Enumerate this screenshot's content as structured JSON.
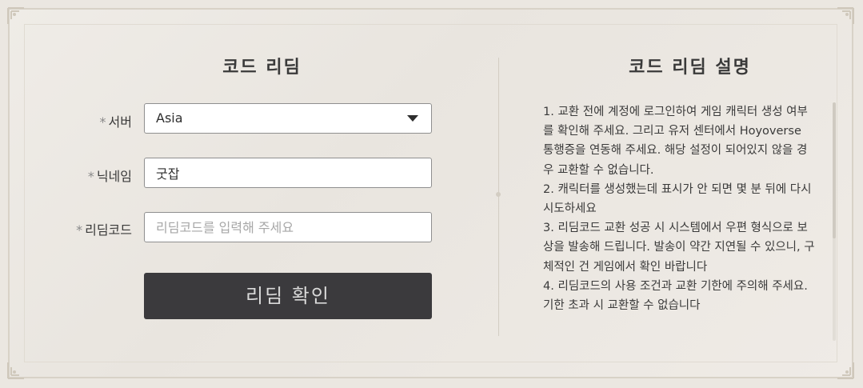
{
  "left": {
    "title": "코드 리딤",
    "server": {
      "required_mark": "*",
      "label": "서버",
      "value": "Asia"
    },
    "nickname": {
      "required_mark": "*",
      "label": "닉네임",
      "value": "굿잡"
    },
    "code": {
      "required_mark": "*",
      "label": "리딤코드",
      "placeholder": "리딤코드를 입력해 주세요"
    },
    "submit_label": "리딤 확인"
  },
  "right": {
    "title": "코드 리딤 설명",
    "items": [
      "1. 교환 전에 계정에 로그인하여 게임 캐릭터 생성 여부를 확인해 주세요. 그리고 유저 센터에서 Hoyoverse 통행증을 연동해 주세요. 해당 설정이 되어있지 않을 경우 교환할 수 없습니다.",
      "2. 캐릭터를 생성했는데 표시가 안 되면 몇 분 뒤에 다시 시도하세요",
      "3. 리딤코드 교환 성공 시 시스템에서 우편 형식으로 보상을 발송해 드립니다. 발송이 약간 지연될 수 있으니, 구체적인 건 게임에서 확인 바랍니다",
      "4. 리딤코드의 사용 조건과 교환 기한에 주의해 주세요. 기한 초과 시 교환할 수 없습니다"
    ]
  },
  "icons": {
    "dropdown": "chevron-down-icon",
    "corner": "corner-ornament-icon"
  },
  "colors": {
    "background": "#ebe7e1",
    "button": "#3b3a3d",
    "button_text": "#d9d9d9",
    "border": "#8f8f8f"
  }
}
